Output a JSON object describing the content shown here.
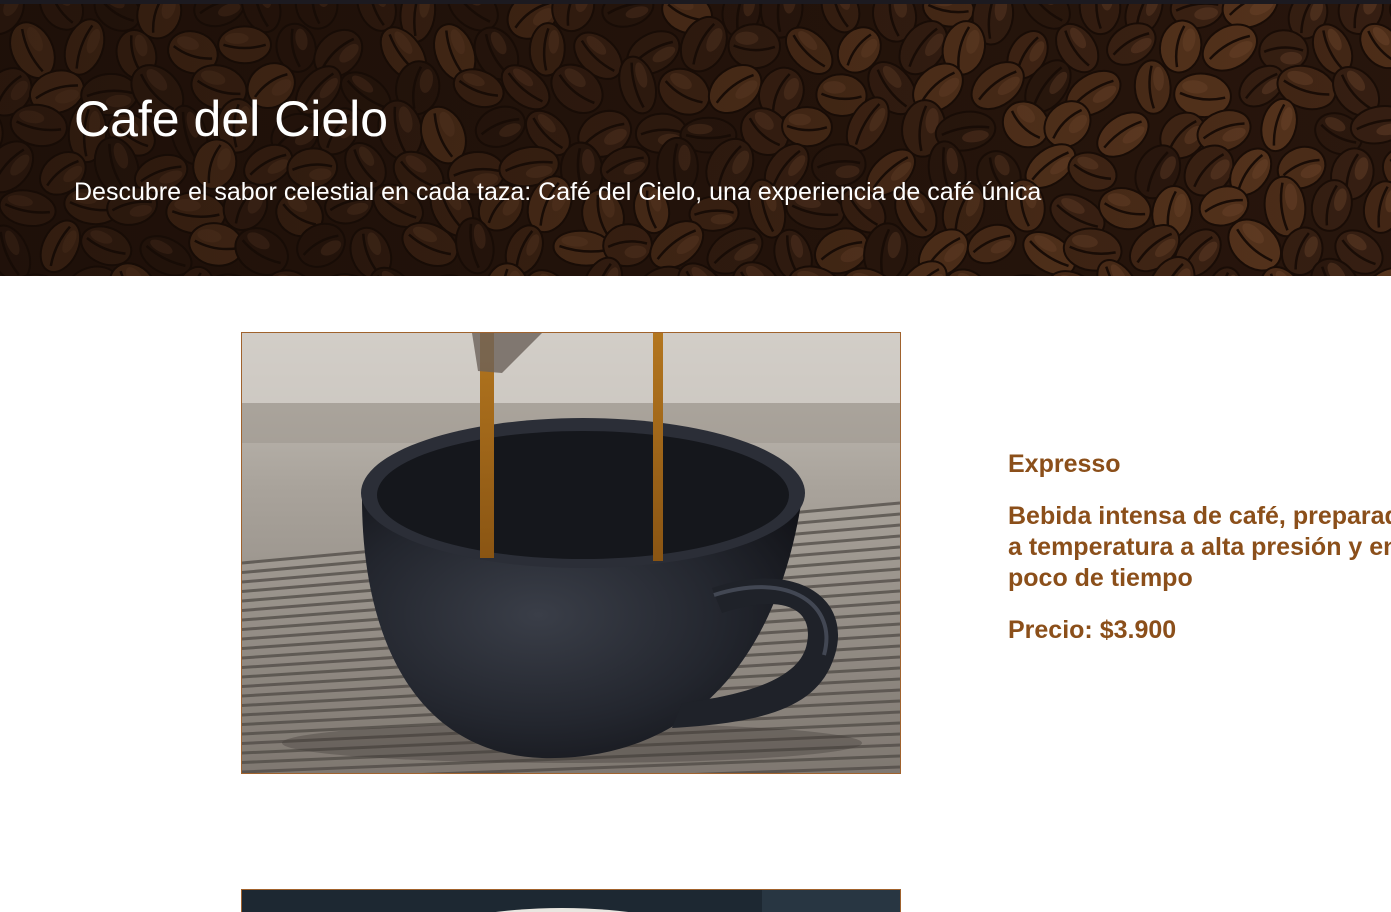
{
  "header": {
    "title": "Cafe del Cielo",
    "subtitle": "Descubre el sabor celestial en cada taza: Café del Cielo, una experiencia de café única",
    "background_icon": "coffee-beans-image"
  },
  "products": [
    {
      "image_icon": "espresso-cup-image",
      "name": "Expresso",
      "description": "Bebida intensa de café, preparada a temperatura a alta presión y en poco de tiempo",
      "price": "Precio: $3.900"
    },
    {
      "image_icon": "coffee-cup-image"
    }
  ],
  "colors": {
    "accent_text": "#8b4f1a",
    "image_border": "#a0622d",
    "header_text": "#ffffff"
  }
}
